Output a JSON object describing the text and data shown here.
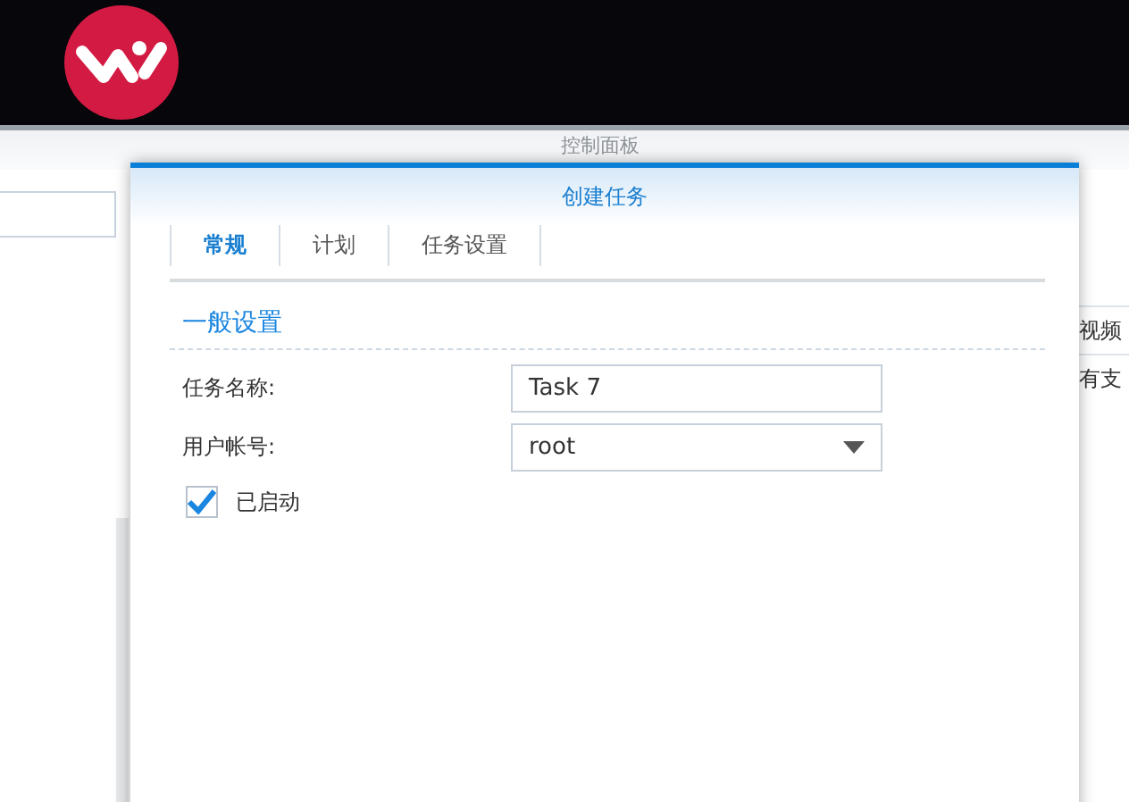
{
  "background": {
    "window_title": "控制面板",
    "right_texts": [
      "视频",
      "有支"
    ]
  },
  "dialog": {
    "title": "创建任务",
    "tabs": [
      {
        "label": "常规",
        "selected": true
      },
      {
        "label": "计划",
        "selected": false
      },
      {
        "label": "任务设置",
        "selected": false
      }
    ],
    "section": "一般设置",
    "fields": [
      {
        "kind": "text",
        "label": "任务名称:",
        "value": "Task 7"
      },
      {
        "kind": "select",
        "label": "用户帐号:",
        "value": "root"
      }
    ],
    "enabled": {
      "label": "已启动",
      "checked": true
    }
  }
}
